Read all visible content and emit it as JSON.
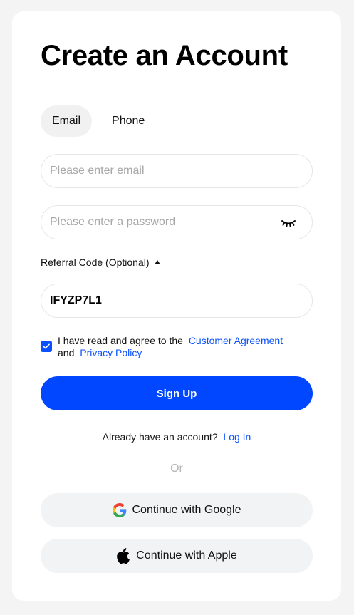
{
  "page": {
    "title": "Create an Account"
  },
  "tabs": [
    {
      "label": "Email",
      "active": true
    },
    {
      "label": "Phone",
      "active": false
    }
  ],
  "email_field": {
    "placeholder": "Please enter email",
    "value": ""
  },
  "password_field": {
    "placeholder": "Please enter a password",
    "value": "",
    "icon": "eye-closed-icon"
  },
  "referral": {
    "label": "Referral Code (Optional)",
    "expanded": true,
    "value": "IFYZP7L1"
  },
  "agreement": {
    "checked": true,
    "text_before": "I have read and agree to the",
    "customer_agreement": "Customer Agreement",
    "and": "and",
    "privacy_policy": "Privacy Policy"
  },
  "signup_button": "Sign Up",
  "login": {
    "prompt": "Already have an account?",
    "link": "Log In"
  },
  "divider": "Or",
  "social": {
    "google": "Continue with Google",
    "apple": "Continue with Apple"
  },
  "colors": {
    "accent": "#0047ff",
    "link": "#0b50ff",
    "background": "#f4f4f4",
    "card": "#ffffff",
    "social_bg": "#f2f3f4"
  }
}
